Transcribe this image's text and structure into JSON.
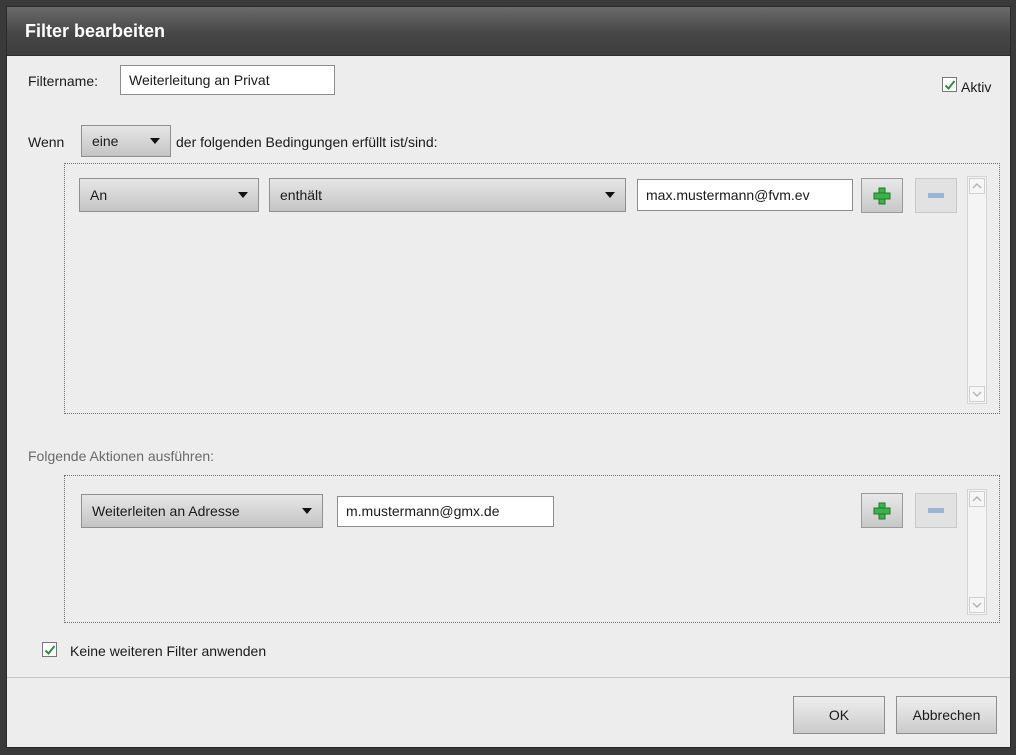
{
  "dialog": {
    "title": "Filter bearbeiten"
  },
  "filtername": {
    "label": "Filtername:",
    "value": "Weiterleitung an Privat"
  },
  "aktiv": {
    "label": "Aktiv",
    "checked": true
  },
  "conditions": {
    "prefix": "Wenn",
    "match_select": "eine",
    "suffix": "der folgenden Bedingungen erfüllt ist/sind:",
    "rows": [
      {
        "field": "An",
        "operator": "enthält",
        "value": "max.mustermann@fvm.ev"
      }
    ]
  },
  "actions": {
    "heading": "Folgende Aktionen ausführen:",
    "rows": [
      {
        "action": "Weiterleiten an Adresse",
        "value": "m.mustermann@gmx.de"
      }
    ]
  },
  "stop_filters": {
    "label": "Keine weiteren Filter anwenden",
    "checked": true
  },
  "buttons": {
    "ok": "OK",
    "cancel": "Abbrechen"
  },
  "icons": {
    "add": "plus-icon",
    "remove": "minus-icon",
    "scroll_up": "chevron-up-icon",
    "scroll_down": "chevron-down-icon",
    "dropdown": "caret-down-icon",
    "check": "checkmark-icon"
  },
  "colors": {
    "add_green": "#3cb34a",
    "remove_blue": "#9ab6d6",
    "check_green": "#2f8f3a"
  }
}
